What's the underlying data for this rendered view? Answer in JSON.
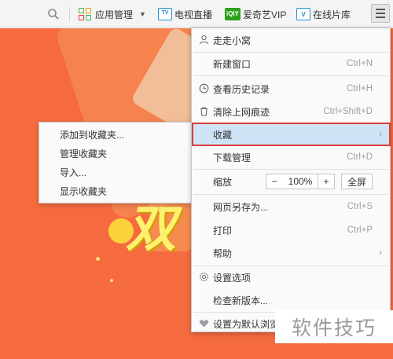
{
  "toolbar": {
    "apps_label": "应用管理",
    "tv_label": "电视直播",
    "tv_badge": "TV",
    "iqiyi_label": "爱奇艺VIP",
    "iqiyi_badge": "iQIY",
    "vip_label": "在线片库",
    "vip_badge": "V"
  },
  "page": {
    "banner_text": "双"
  },
  "menu": {
    "user": "走走小窝",
    "items": [
      {
        "label": "新建窗口",
        "shortcut": "Ctrl+N"
      },
      {
        "label": "查看历史记录",
        "shortcut": "Ctrl+H"
      },
      {
        "label": "清除上网痕迹",
        "shortcut": "Ctrl+Shift+D"
      },
      {
        "label": "收藏",
        "shortcut": ""
      },
      {
        "label": "下载管理",
        "shortcut": "Ctrl+D"
      },
      {
        "label": "缩放",
        "shortcut": ""
      },
      {
        "label": "网页另存为...",
        "shortcut": "Ctrl+S"
      },
      {
        "label": "打印",
        "shortcut": "Ctrl+P"
      },
      {
        "label": "帮助",
        "shortcut": ""
      },
      {
        "label": "设置选项",
        "shortcut": ""
      },
      {
        "label": "检查新版本...",
        "shortcut": ""
      },
      {
        "label": "设置为默认浏览",
        "shortcut": ""
      }
    ],
    "zoom": {
      "minus": "−",
      "value": "100%",
      "plus": "+",
      "fullscreen": "全屏"
    }
  },
  "submenu": {
    "items": [
      "添加到收藏夹...",
      "管理收藏夹",
      "导入...",
      "显示收藏夹"
    ]
  },
  "watermark": "软件技巧",
  "colors": {
    "page_bg": "#f56b3f",
    "highlight_bg": "#cfe3f7",
    "highlight_border": "#d9403a",
    "accent_blue": "#1e90d6"
  }
}
